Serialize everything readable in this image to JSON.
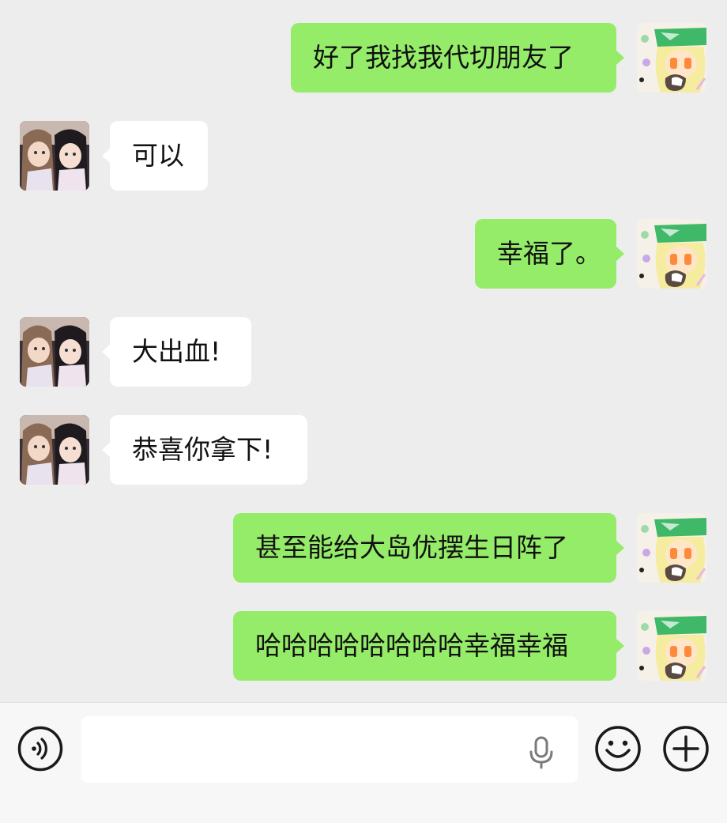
{
  "messages": [
    {
      "side": "out",
      "text": "好了我找我代切朋友了"
    },
    {
      "side": "in",
      "text": "可以"
    },
    {
      "side": "out",
      "text": "幸福了。"
    },
    {
      "side": "in",
      "text": "大出血!"
    },
    {
      "side": "in",
      "text": "恭喜你拿下!"
    },
    {
      "side": "out",
      "text": "甚至能给大岛优摆生日阵了"
    },
    {
      "side": "out",
      "text": "哈哈哈哈哈哈哈哈幸福幸福"
    }
  ],
  "input_bar": {
    "voice_icon": "voice-mode-icon",
    "mic_icon": "microphone-icon",
    "emoji_icon": "emoji-icon",
    "plus_icon": "plus-icon",
    "input_value": ""
  },
  "colors": {
    "background": "#ededed",
    "outgoing_bubble": "#95ec69",
    "incoming_bubble": "#ffffff"
  }
}
